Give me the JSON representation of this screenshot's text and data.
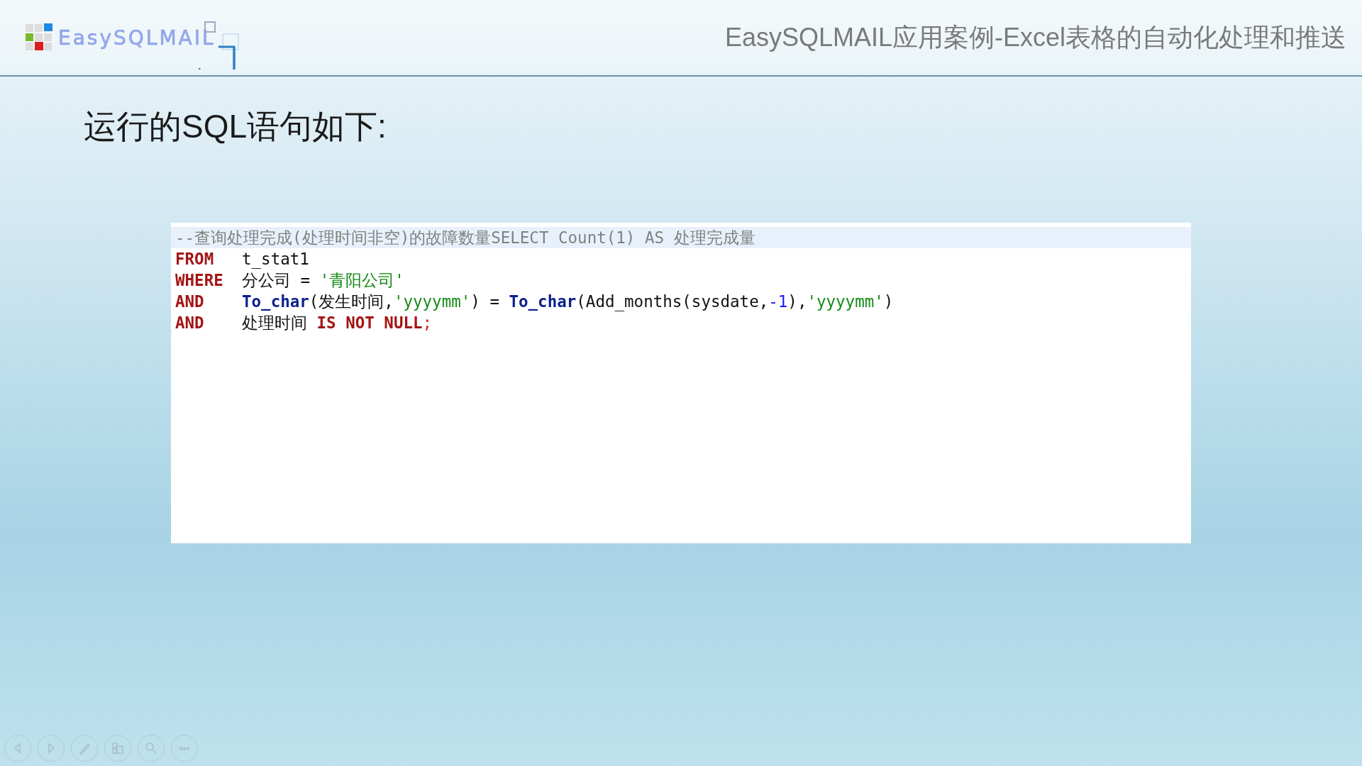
{
  "header": {
    "logo_text": "EasySQLMAIL",
    "title": "EasySQLMAIL应用案例-Excel表格的自动化处理和推送"
  },
  "slide": {
    "heading": "运行的SQL语句如下:",
    "code_lines": [
      {
        "highlighted": true,
        "tokens": [
          {
            "kind": "comment",
            "text": "--查询处理完成(处理时间非空)的故障数量SELECT Count(1) AS 处理完成量"
          }
        ]
      },
      {
        "highlighted": false,
        "lead": "FROM",
        "tokens": [
          {
            "kind": "plain",
            "text": "t_stat1"
          }
        ]
      },
      {
        "highlighted": false,
        "lead": "WHERE",
        "tokens": [
          {
            "kind": "plain",
            "text": "分公司 = "
          },
          {
            "kind": "string",
            "text": "'青阳公司'"
          }
        ]
      },
      {
        "highlighted": false,
        "lead": "AND",
        "tokens": [
          {
            "kind": "function",
            "text": "To_char"
          },
          {
            "kind": "plain",
            "text": "(发生时间,"
          },
          {
            "kind": "string",
            "text": "'yyyymm'"
          },
          {
            "kind": "plain",
            "text": ") = "
          },
          {
            "kind": "function",
            "text": "To_char"
          },
          {
            "kind": "plain",
            "text": "(Add_months(sysdate,"
          },
          {
            "kind": "number",
            "text": "-1"
          },
          {
            "kind": "plain",
            "text": "),"
          },
          {
            "kind": "string",
            "text": "'yyyymm'"
          },
          {
            "kind": "plain",
            "text": ")"
          }
        ]
      },
      {
        "highlighted": false,
        "lead": "AND",
        "tokens": [
          {
            "kind": "plain",
            "text": "处理时间 "
          },
          {
            "kind": "keyword",
            "text": "IS NOT NULL"
          },
          {
            "kind": "punct",
            "text": ";"
          }
        ]
      }
    ]
  }
}
